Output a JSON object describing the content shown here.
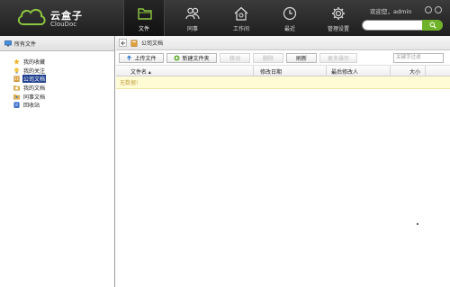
{
  "brand": {
    "name": "云盒子",
    "sub": "ClouDoc"
  },
  "nav": [
    {
      "label": "文件",
      "icon": "folder-icon",
      "active": true
    },
    {
      "label": "同事",
      "icon": "people-icon"
    },
    {
      "label": "工作间",
      "icon": "house-icon"
    },
    {
      "label": "最近",
      "icon": "clock-icon"
    },
    {
      "label": "管理设置",
      "icon": "gear-icon"
    }
  ],
  "user": {
    "welcome": "欢迎您，admin"
  },
  "sidebar": {
    "title": "所有文件",
    "items": [
      {
        "label": "我的收藏",
        "icon": "star-icon",
        "color": "#f2b01e"
      },
      {
        "label": "我的关注",
        "icon": "bulb-icon",
        "color": "#f2b01e"
      },
      {
        "label": "公司文档",
        "icon": "building-icon",
        "color": "#e0a13a",
        "selected": true
      },
      {
        "label": "我的文档",
        "icon": "doc-folder-icon",
        "color": "#e8b44a"
      },
      {
        "label": "同事文档",
        "icon": "share-folder-icon",
        "color": "#e8b44a"
      },
      {
        "label": "回收站",
        "icon": "recycle-bin-icon",
        "color": "#3a6fd0"
      }
    ]
  },
  "breadcrumb": {
    "current": "公司文档"
  },
  "toolbar": {
    "upload": "上传文件",
    "new_folder": "新建文件夹",
    "move": "移动",
    "delete": "删除",
    "refresh": "刷新",
    "more": "更多操作",
    "filter_placeholder": "关键字过滤"
  },
  "table": {
    "columns": [
      "文件名 ▴",
      "修改日期",
      "最后修改人",
      "大小"
    ],
    "empty_text": "无数据!"
  }
}
